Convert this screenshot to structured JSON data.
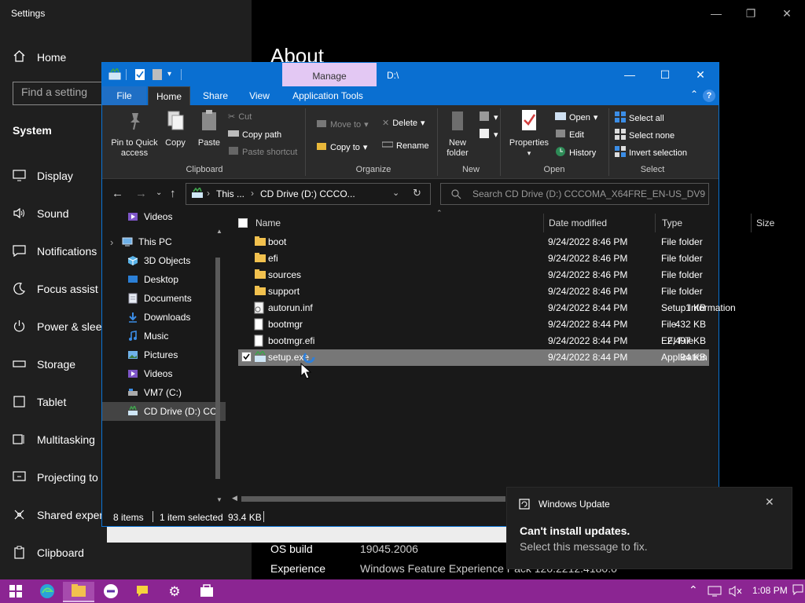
{
  "settings": {
    "title": "Settings",
    "home": "Home",
    "search_placeholder": "Find a setting",
    "section": "System",
    "nav_items": [
      "Display",
      "Sound",
      "Notifications",
      "Focus assist",
      "Power & sleep",
      "Storage",
      "Tablet",
      "Multitasking",
      "Projecting to",
      "Shared exper",
      "Clipboard"
    ],
    "about_heading": "About",
    "specs": [
      {
        "label": "OS build",
        "value": "19045.2006"
      },
      {
        "label": "Experience",
        "value": "Windows Feature Experience Pack 120.2212.4180.0"
      }
    ]
  },
  "explorer": {
    "title_path": "D:\\",
    "manage_tab": "Manage",
    "tabs": [
      "File",
      "Home",
      "Share",
      "View",
      "Application Tools"
    ],
    "ribbon": {
      "pin_to_quick_access": "Pin to Quick access",
      "copy": "Copy",
      "paste": "Paste",
      "cut": "Cut",
      "copy_path": "Copy path",
      "paste_shortcut": "Paste shortcut",
      "clipboard_group": "Clipboard",
      "move_to": "Move to",
      "copy_to": "Copy to",
      "delete": "Delete",
      "rename": "Rename",
      "organize_group": "Organize",
      "new_folder": "New folder",
      "new_group": "New",
      "properties": "Properties",
      "open": "Open",
      "edit": "Edit",
      "history": "History",
      "open_group": "Open",
      "select_all": "Select all",
      "select_none": "Select none",
      "invert_selection": "Invert selection",
      "select_group": "Select"
    },
    "address": {
      "crumb1": "This ...",
      "crumb2": "CD Drive (D:) CCCO..."
    },
    "search_placeholder": "Search CD Drive (D:) CCCOMA_X64FRE_EN-US_DV9",
    "nav_pane": [
      {
        "label": "Downloads",
        "icon": "download-arrow-icon",
        "pinned": true
      },
      {
        "label": "Documents",
        "icon": "documents-icon",
        "pinned": true
      },
      {
        "label": "Pictures",
        "icon": "pictures-icon",
        "pinned": true
      },
      {
        "label": "Music",
        "icon": "music-icon",
        "pinned": false
      },
      {
        "label": "Videos",
        "icon": "videos-icon",
        "pinned": false
      },
      {
        "label": "This PC",
        "icon": "this-pc-icon",
        "pinned": false
      },
      {
        "label": "3D Objects",
        "icon": "3d-objects-icon",
        "pinned": false
      },
      {
        "label": "Desktop",
        "icon": "desktop-icon",
        "pinned": false
      },
      {
        "label": "Documents",
        "icon": "documents-icon",
        "pinned": false
      },
      {
        "label": "Downloads",
        "icon": "download-arrow-icon",
        "pinned": false
      },
      {
        "label": "Music",
        "icon": "music-icon",
        "pinned": false
      },
      {
        "label": "Pictures",
        "icon": "pictures-icon",
        "pinned": false
      },
      {
        "label": "Videos",
        "icon": "videos-icon",
        "pinned": false
      },
      {
        "label": "VM7 (C:)",
        "icon": "drive-icon",
        "pinned": false
      },
      {
        "label": "CD Drive (D:) CC",
        "icon": "cd-drive-icon",
        "pinned": false
      }
    ],
    "columns": [
      "Name",
      "Date modified",
      "Type",
      "Size"
    ],
    "files": [
      {
        "name": "boot",
        "date": "9/24/2022 8:46 PM",
        "type": "File folder",
        "size": "",
        "kind": "folder"
      },
      {
        "name": "efi",
        "date": "9/24/2022 8:46 PM",
        "type": "File folder",
        "size": "",
        "kind": "folder"
      },
      {
        "name": "sources",
        "date": "9/24/2022 8:46 PM",
        "type": "File folder",
        "size": "",
        "kind": "folder"
      },
      {
        "name": "support",
        "date": "9/24/2022 8:46 PM",
        "type": "File folder",
        "size": "",
        "kind": "folder"
      },
      {
        "name": "autorun.inf",
        "date": "9/24/2022 8:44 PM",
        "type": "Setup Information",
        "size": "1 KB",
        "kind": "setup"
      },
      {
        "name": "bootmgr",
        "date": "9/24/2022 8:44 PM",
        "type": "File",
        "size": "432 KB",
        "kind": "file"
      },
      {
        "name": "bootmgr.efi",
        "date": "9/24/2022 8:44 PM",
        "type": "EFI File",
        "size": "2,497 KB",
        "kind": "file"
      },
      {
        "name": "setup.exe",
        "date": "9/24/2022 8:44 PM",
        "type": "Application",
        "size": "94 KB",
        "kind": "app"
      }
    ],
    "status": {
      "items": "8 items",
      "selected": "1 item selected",
      "size": "93.4 KB"
    }
  },
  "toast": {
    "app": "Windows Update",
    "title": "Can't install updates.",
    "message": "Select this message to fix."
  },
  "taskbar": {
    "time": "1:08 PM"
  },
  "colors": {
    "accent": "#0a6fd1",
    "taskbar": "#8b2592",
    "manage_tab": "#e3c8f3",
    "folder": "#f2c14e"
  }
}
